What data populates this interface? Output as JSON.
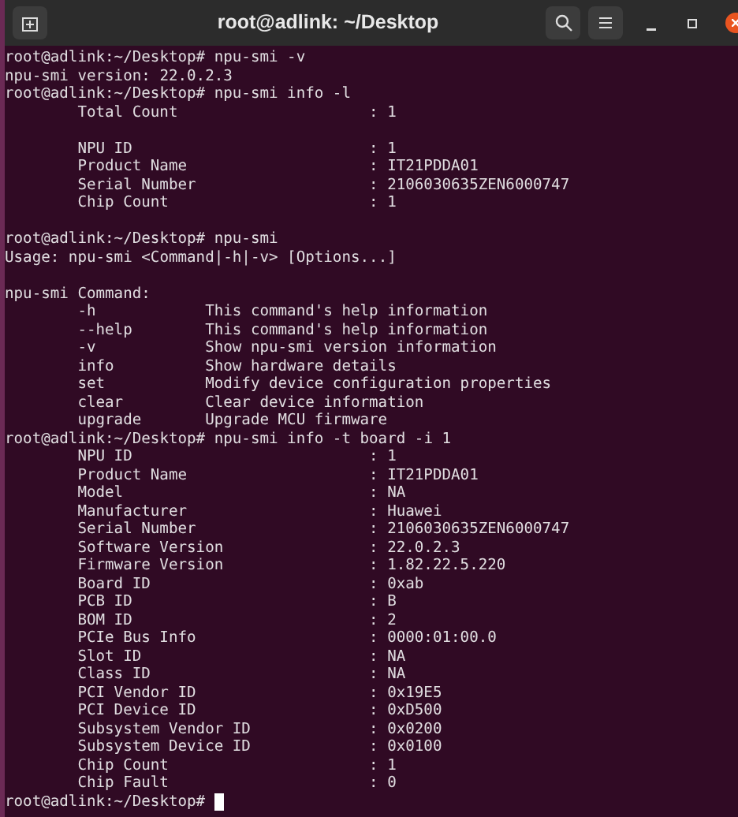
{
  "window": {
    "title": "root@adlink: ~/Desktop"
  },
  "terminal": {
    "lines": [
      {
        "kind": "prompt",
        "prompt": "root@adlink:~/Desktop#",
        "command": "npu-smi -v"
      },
      {
        "kind": "output",
        "text": "npu-smi version: 22.0.2.3"
      },
      {
        "kind": "prompt",
        "prompt": "root@adlink:~/Desktop#",
        "command": "npu-smi info -l"
      },
      {
        "kind": "field",
        "key": "Total Count",
        "value": ": 1"
      },
      {
        "kind": "blank"
      },
      {
        "kind": "field",
        "key": "NPU ID",
        "value": ": 1"
      },
      {
        "kind": "field",
        "key": "Product Name",
        "value": ": IT21PDDA01"
      },
      {
        "kind": "field",
        "key": "Serial Number",
        "value": ": 2106030635ZEN6000747"
      },
      {
        "kind": "field",
        "key": "Chip Count",
        "value": ": 1"
      },
      {
        "kind": "blank"
      },
      {
        "kind": "prompt",
        "prompt": "root@adlink:~/Desktop#",
        "command": "npu-smi"
      },
      {
        "kind": "output",
        "text": "Usage: npu-smi <Command|-h|-v> [Options...]"
      },
      {
        "kind": "blank"
      },
      {
        "kind": "output",
        "text": "npu-smi Command:"
      },
      {
        "kind": "option",
        "key": "-h",
        "value": "This command's help information"
      },
      {
        "kind": "option",
        "key": "--help",
        "value": "This command's help information"
      },
      {
        "kind": "option",
        "key": "-v",
        "value": "Show npu-smi version information"
      },
      {
        "kind": "option",
        "key": "info",
        "value": "Show hardware details"
      },
      {
        "kind": "option",
        "key": "set",
        "value": "Modify device configuration properties"
      },
      {
        "kind": "option",
        "key": "clear",
        "value": "Clear device information"
      },
      {
        "kind": "option",
        "key": "upgrade",
        "value": "Upgrade MCU firmware"
      },
      {
        "kind": "prompt",
        "prompt": "root@adlink:~/Desktop#",
        "command": "npu-smi info -t board -i 1"
      },
      {
        "kind": "field",
        "key": "NPU ID",
        "value": ": 1"
      },
      {
        "kind": "field",
        "key": "Product Name",
        "value": ": IT21PDDA01"
      },
      {
        "kind": "field",
        "key": "Model",
        "value": ": NA"
      },
      {
        "kind": "field",
        "key": "Manufacturer",
        "value": ": Huawei"
      },
      {
        "kind": "field",
        "key": "Serial Number",
        "value": ": 2106030635ZEN6000747"
      },
      {
        "kind": "field",
        "key": "Software Version",
        "value": ": 22.0.2.3"
      },
      {
        "kind": "field",
        "key": "Firmware Version",
        "value": ": 1.82.22.5.220"
      },
      {
        "kind": "field",
        "key": "Board ID",
        "value": ": 0xab"
      },
      {
        "kind": "field",
        "key": "PCB ID",
        "value": ": B"
      },
      {
        "kind": "field",
        "key": "BOM ID",
        "value": ": 2"
      },
      {
        "kind": "field",
        "key": "PCIe Bus Info",
        "value": ": 0000:01:00.0"
      },
      {
        "kind": "field",
        "key": "Slot ID",
        "value": ": NA"
      },
      {
        "kind": "field",
        "key": "Class ID",
        "value": ": NA"
      },
      {
        "kind": "field",
        "key": "PCI Vendor ID",
        "value": ": 0x19E5"
      },
      {
        "kind": "field",
        "key": "PCI Device ID",
        "value": ": 0xD500"
      },
      {
        "kind": "field",
        "key": "Subsystem Vendor ID",
        "value": ": 0x0200"
      },
      {
        "kind": "field",
        "key": "Subsystem Device ID",
        "value": ": 0x0100"
      },
      {
        "kind": "field",
        "key": "Chip Count",
        "value": ": 1"
      },
      {
        "kind": "field",
        "key": "Chip Fault",
        "value": ": 0"
      },
      {
        "kind": "prompt",
        "prompt": "root@adlink:~/Desktop#",
        "cursor": true
      }
    ]
  }
}
